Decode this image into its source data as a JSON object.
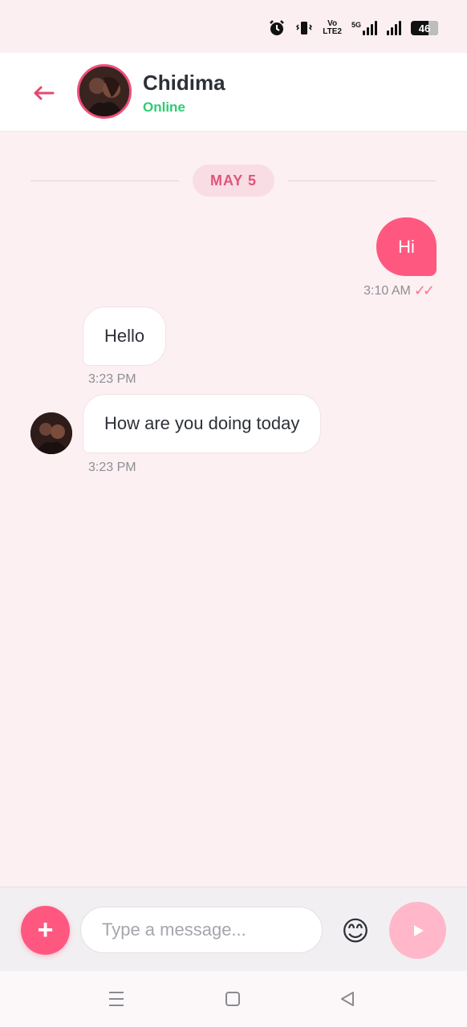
{
  "status_bar": {
    "icons": [
      "alarm-icon",
      "vibrate-icon",
      "volte-icon",
      "5g-signal-icon",
      "signal-icon",
      "battery-icon"
    ],
    "volte_top": "Vo",
    "volte_bottom": "LTE2",
    "network": "5G",
    "battery": "46"
  },
  "header": {
    "back_icon": "arrow-left-icon",
    "name": "Chidima",
    "status": "Online"
  },
  "date_separator": "MAY 5",
  "messages": [
    {
      "direction": "out",
      "text": "Hi",
      "time": "3:10 AM",
      "read_icon": "double-check-icon"
    },
    {
      "direction": "in",
      "text": "Hello",
      "time": "3:23 PM"
    },
    {
      "direction": "in",
      "text": "How are you doing today",
      "time": "3:23 PM"
    }
  ],
  "composer": {
    "add_icon": "+",
    "placeholder": "Type a message...",
    "emoji": "😊",
    "send_icon": "send-icon"
  },
  "nav": {
    "icons": [
      "menu-icon",
      "home-icon",
      "back-icon"
    ]
  },
  "colors": {
    "accent": "#ff5880",
    "online": "#2ecc71",
    "background": "#fcf0f2"
  }
}
